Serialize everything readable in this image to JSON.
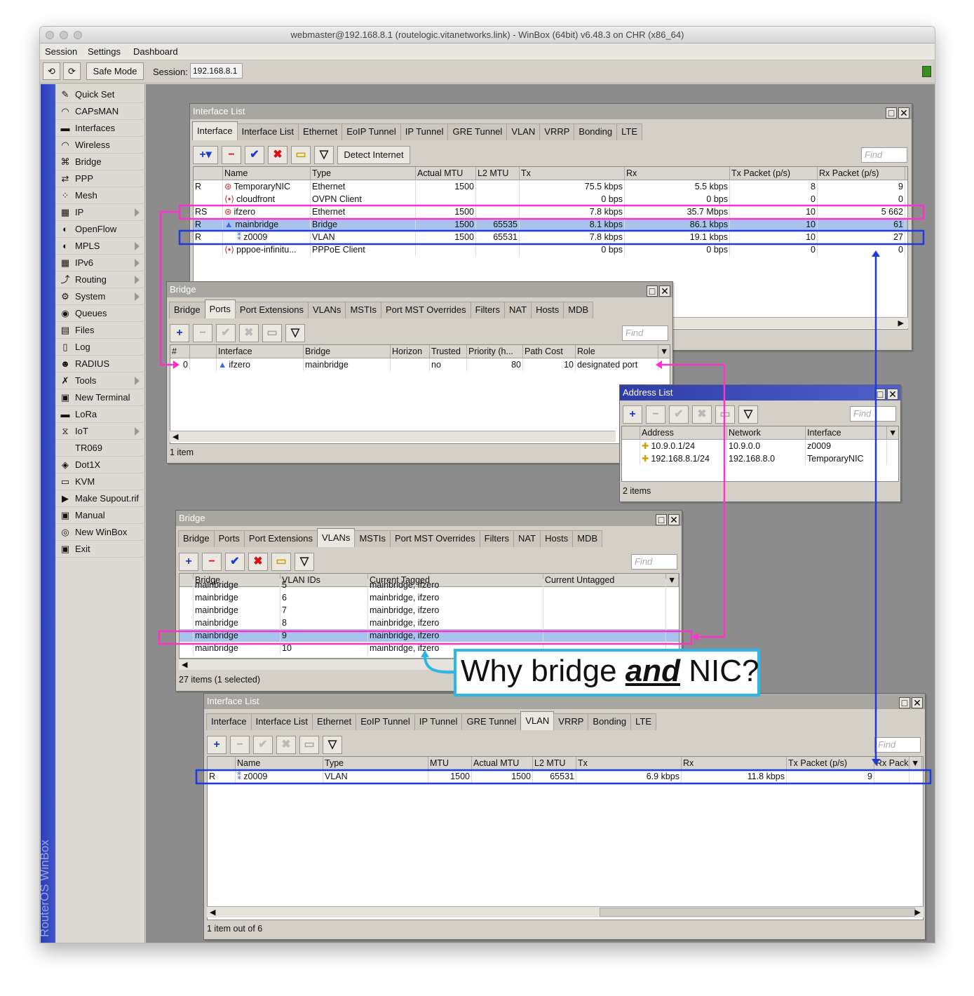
{
  "window_title": "webmaster@192.168.8.1 (routelogic.vitanetworks.link) - WinBox (64bit) v6.48.3 on CHR (x86_64)",
  "menu": [
    "Session",
    "Settings",
    "Dashboard"
  ],
  "toolbar": {
    "safe_mode": "Safe Mode",
    "session_label": "Session:",
    "session_value": "192.168.8.1"
  },
  "brand_vertical": "RouterOS WinBox",
  "sidebar": [
    {
      "label": "Quick Set",
      "icon": "wand-icon",
      "arrow": false
    },
    {
      "label": "CAPsMAN",
      "icon": "antenna-icon",
      "arrow": false
    },
    {
      "label": "Interfaces",
      "icon": "interfaces-icon",
      "arrow": false
    },
    {
      "label": "Wireless",
      "icon": "wireless-icon",
      "arrow": false
    },
    {
      "label": "Bridge",
      "icon": "bridge-icon",
      "arrow": false
    },
    {
      "label": "PPP",
      "icon": "ppp-icon",
      "arrow": false
    },
    {
      "label": "Mesh",
      "icon": "mesh-icon",
      "arrow": false
    },
    {
      "label": "IP",
      "icon": "ip-icon",
      "arrow": true
    },
    {
      "label": "OpenFlow",
      "icon": "openflow-icon",
      "arrow": false
    },
    {
      "label": "MPLS",
      "icon": "mpls-icon",
      "arrow": true
    },
    {
      "label": "IPv6",
      "icon": "ipv6-icon",
      "arrow": true
    },
    {
      "label": "Routing",
      "icon": "routing-icon",
      "arrow": true
    },
    {
      "label": "System",
      "icon": "system-icon",
      "arrow": true
    },
    {
      "label": "Queues",
      "icon": "queues-icon",
      "arrow": false
    },
    {
      "label": "Files",
      "icon": "files-icon",
      "arrow": false
    },
    {
      "label": "Log",
      "icon": "log-icon",
      "arrow": false
    },
    {
      "label": "RADIUS",
      "icon": "radius-icon",
      "arrow": false
    },
    {
      "label": "Tools",
      "icon": "tools-icon",
      "arrow": true
    },
    {
      "label": "New Terminal",
      "icon": "terminal-icon",
      "arrow": false
    },
    {
      "label": "LoRa",
      "icon": "lora-icon",
      "arrow": false
    },
    {
      "label": "IoT",
      "icon": "iot-icon",
      "arrow": true
    },
    {
      "label": "TR069",
      "icon": "",
      "arrow": false
    },
    {
      "label": "Dot1X",
      "icon": "dot1x-icon",
      "arrow": false
    },
    {
      "label": "KVM",
      "icon": "kvm-icon",
      "arrow": false
    },
    {
      "label": "Make Supout.rif",
      "icon": "supout-icon",
      "arrow": false
    },
    {
      "label": "Manual",
      "icon": "manual-icon",
      "arrow": false
    },
    {
      "label": "New WinBox",
      "icon": "winbox-icon",
      "arrow": false
    },
    {
      "label": "Exit",
      "icon": "exit-icon",
      "arrow": false
    }
  ],
  "iface_win": {
    "title": "Interface List",
    "tabs": [
      "Interface",
      "Interface List",
      "Ethernet",
      "EoIP Tunnel",
      "IP Tunnel",
      "GRE Tunnel",
      "VLAN",
      "VRRP",
      "Bonding",
      "LTE"
    ],
    "active_tab": 0,
    "detect": "Detect Internet",
    "find": "Find",
    "columns": [
      "",
      "Name",
      "Type",
      "Actual MTU",
      "L2 MTU",
      "Tx",
      "Rx",
      "Tx Packet (p/s)",
      "Rx Packet (p/s)"
    ],
    "rows": [
      [
        "R",
        "TemporaryNIC",
        "Ethernet",
        "1500",
        "",
        "75.5 kbps",
        "5.5 kbps",
        "8",
        "9"
      ],
      [
        "",
        "cloudfront",
        "OVPN Client",
        "",
        "",
        "0 bps",
        "0 bps",
        "0",
        "0"
      ],
      [
        "RS",
        "ifzero",
        "Ethernet",
        "1500",
        "",
        "7.8 kbps",
        "35.7 Mbps",
        "10",
        "5 662"
      ],
      [
        "R",
        "mainbridge",
        "Bridge",
        "1500",
        "65535",
        "8.1 kbps",
        "86.1 kbps",
        "10",
        "61"
      ],
      [
        "R",
        "z0009",
        "VLAN",
        "1500",
        "65531",
        "7.8 kbps",
        "19.1 kbps",
        "10",
        "27"
      ],
      [
        "",
        "pppoe-infinitu...",
        "PPPoE Client",
        "",
        "",
        "0 bps",
        "0 bps",
        "0",
        "0"
      ]
    ],
    "selected_row": 3
  },
  "bridge_ports_win": {
    "title": "Bridge",
    "tabs": [
      "Bridge",
      "Ports",
      "Port Extensions",
      "VLANs",
      "MSTIs",
      "Port MST Overrides",
      "Filters",
      "NAT",
      "Hosts",
      "MDB"
    ],
    "active_tab": 1,
    "find": "Find",
    "columns": [
      "#",
      "",
      "Interface",
      "Bridge",
      "Horizon",
      "Trusted",
      "Priority (h...",
      "Path Cost",
      "Role"
    ],
    "rows": [
      [
        "0",
        "",
        "ifzero",
        "mainbridge",
        "",
        "no",
        "80",
        "10",
        "designated port"
      ]
    ],
    "status": "1 item"
  },
  "address_win": {
    "title": "Address List",
    "find": "Find",
    "columns": [
      "",
      "Address",
      "Network",
      "Interface"
    ],
    "rows": [
      [
        "",
        "10.9.0.1/24",
        "10.9.0.0",
        "z0009"
      ],
      [
        "",
        "192.168.8.1/24",
        "192.168.8.0",
        "TemporaryNIC"
      ]
    ],
    "status": "2 items"
  },
  "bridge_vlans_win": {
    "title": "Bridge",
    "tabs": [
      "Bridge",
      "Ports",
      "Port Extensions",
      "VLANs",
      "MSTIs",
      "Port MST Overrides",
      "Filters",
      "NAT",
      "Hosts",
      "MDB"
    ],
    "active_tab": 3,
    "find": "Find",
    "columns": [
      "",
      "Bridge",
      "VLAN IDs",
      "Current Tagged",
      "Current Untagged"
    ],
    "rows": [
      [
        "",
        "mainbridge",
        "5",
        "mainbridge, ifzero",
        ""
      ],
      [
        "",
        "mainbridge",
        "6",
        "mainbridge, ifzero",
        ""
      ],
      [
        "",
        "mainbridge",
        "7",
        "mainbridge, ifzero",
        ""
      ],
      [
        "",
        "mainbridge",
        "8",
        "mainbridge, ifzero",
        ""
      ],
      [
        "",
        "mainbridge",
        "9",
        "mainbridge, ifzero",
        ""
      ],
      [
        "",
        "mainbridge",
        "10",
        "mainbridge, ifzero",
        ""
      ]
    ],
    "selected_row": 4,
    "status": "27 items (1 selected)"
  },
  "vlan_win": {
    "title": "Interface List",
    "tabs": [
      "Interface",
      "Interface List",
      "Ethernet",
      "EoIP Tunnel",
      "IP Tunnel",
      "GRE Tunnel",
      "VLAN",
      "VRRP",
      "Bonding",
      "LTE"
    ],
    "active_tab": 6,
    "find": "Find",
    "columns": [
      "",
      "Name",
      "Type",
      "MTU",
      "Actual MTU",
      "L2 MTU",
      "Tx",
      "Rx",
      "Tx Packet (p/s)",
      "Rx Pack"
    ],
    "rows": [
      [
        "R",
        "z0009",
        "VLAN",
        "1500",
        "1500",
        "65531",
        "6.9 kbps",
        "11.8 kbps",
        "9",
        ""
      ]
    ],
    "status": "1 item out of 6"
  },
  "annotation": {
    "pre": "Why bridge ",
    "emph": "and",
    "post": " NIC?"
  },
  "colors": {
    "magenta": "#ff33cc",
    "blue": "#1f3ae0",
    "cyan": "#2bb7e8",
    "selected_row": "#a8c4ee",
    "title_active": "#2e3ea6"
  }
}
